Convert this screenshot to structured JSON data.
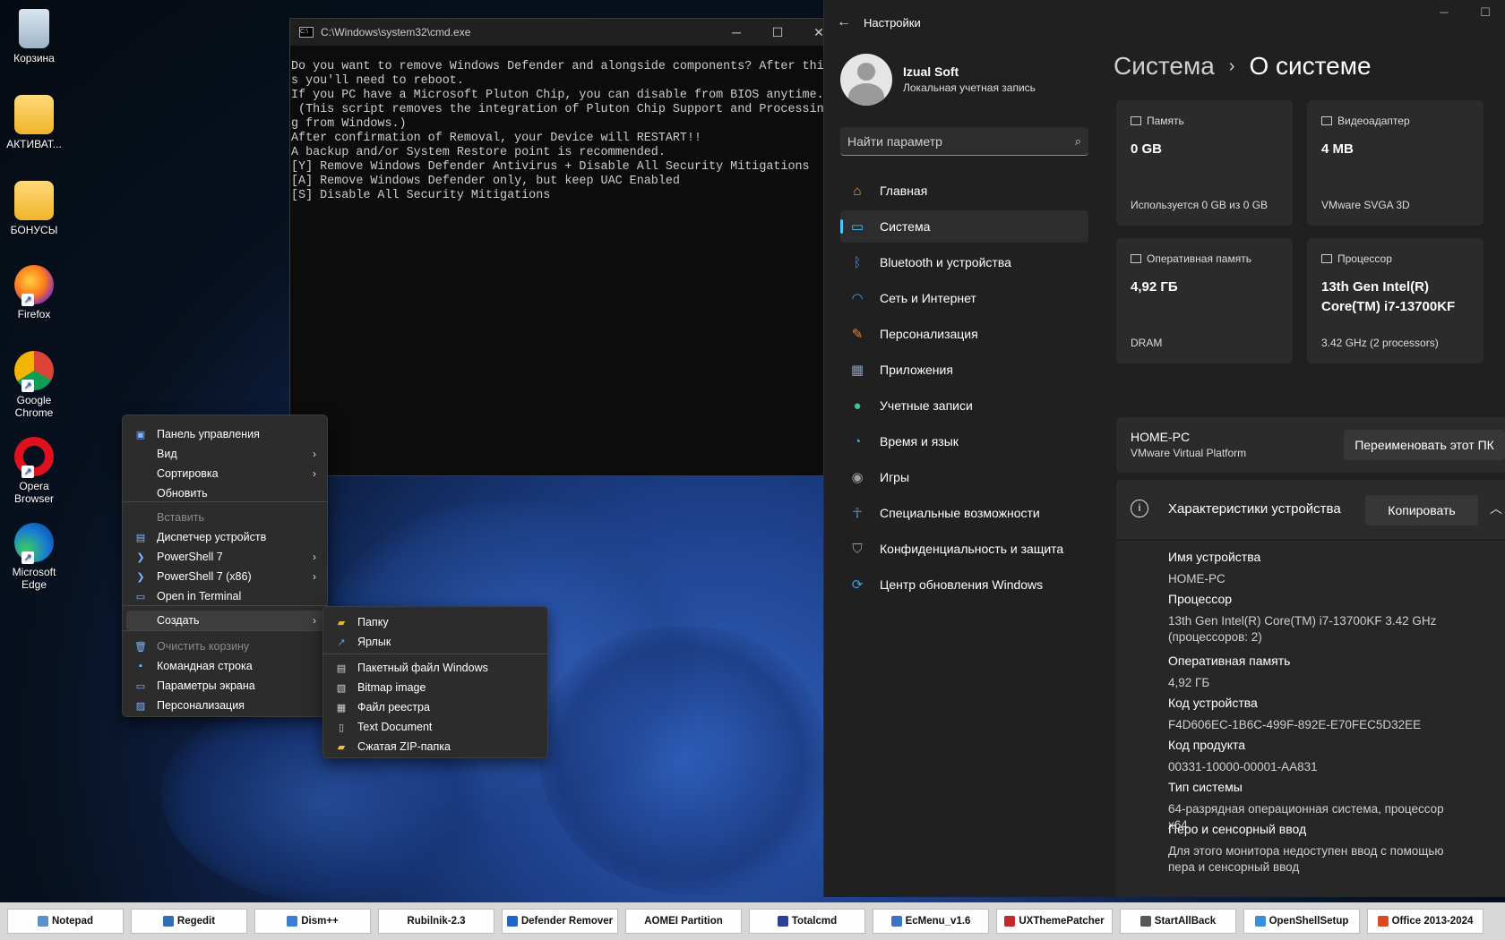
{
  "desktop": {
    "icons": [
      {
        "label": "Корзина",
        "icon": "recycle-bin-icon"
      },
      {
        "label": "АКТИВАТ...",
        "icon": "folder-icon"
      },
      {
        "label": "БОНУСЫ",
        "icon": "folder-icon"
      },
      {
        "label": "Firefox",
        "icon": "firefox-icon"
      },
      {
        "label": "Google Chrome",
        "icon": "chrome-icon"
      },
      {
        "label": "Opera Browser",
        "icon": "opera-icon"
      },
      {
        "label": "Microsoft Edge",
        "icon": "edge-icon"
      }
    ]
  },
  "cmd": {
    "title": "C:\\Windows\\system32\\cmd.exe",
    "lines": [
      "Do you want to remove Windows Defender and alongside components? After thi",
      "s you'll need to reboot.",
      "If you PC have a Microsoft Pluton Chip, you can disable from BIOS anytime.",
      " (This script removes the integration of Pluton Chip Support and Processin",
      "g from Windows.)",
      "After confirmation of Removal, your Device will RESTART!!",
      "A backup and/or System Restore point is recommended.",
      "[Y] Remove Windows Defender Antivirus + Disable All Security Mitigations",
      "[A] Remove Windows Defender only, but keep UAC Enabled",
      "[S] Disable All Security Mitigations"
    ]
  },
  "settings": {
    "window_title": "Настройки",
    "user": {
      "name": "Izual Soft",
      "type": "Локальная учетная запись"
    },
    "search_placeholder": "Найти параметр",
    "nav": [
      {
        "label": "Главная",
        "icon": "home-icon",
        "color": "#e8a33b"
      },
      {
        "label": "Система",
        "icon": "system-icon",
        "color": "#4cc2ff",
        "active": true
      },
      {
        "label": "Bluetooth и устройства",
        "icon": "bluetooth-icon",
        "color": "#2f8ff0"
      },
      {
        "label": "Сеть и Интернет",
        "icon": "wifi-icon",
        "color": "#3aa0e8"
      },
      {
        "label": "Персонализация",
        "icon": "brush-icon",
        "color": "#e88b3a"
      },
      {
        "label": "Приложения",
        "icon": "apps-icon",
        "color": "#8a9bb8"
      },
      {
        "label": "Учетные записи",
        "icon": "accounts-icon",
        "color": "#3ac48a"
      },
      {
        "label": "Время и язык",
        "icon": "time-language-icon",
        "color": "#3aa0e8"
      },
      {
        "label": "Игры",
        "icon": "gamepad-icon",
        "color": "#9aa0a6"
      },
      {
        "label": "Специальные возможности",
        "icon": "accessibility-icon",
        "color": "#3aa0e8"
      },
      {
        "label": "Конфиденциальность и защита",
        "icon": "shield-icon",
        "color": "#9aa0a6"
      },
      {
        "label": "Центр обновления Windows",
        "icon": "update-icon",
        "color": "#3aa0e8"
      }
    ],
    "breadcrumb": {
      "parent": "Система",
      "separator": "›",
      "current": "О системе"
    },
    "cards": [
      {
        "label": "Память",
        "value": "0 GB",
        "sub": "Используется 0 GB из 0 GB"
      },
      {
        "label": "Видеоадаптер",
        "value": "4 MB",
        "sub": "VMware SVGA 3D"
      },
      {
        "label": "Оперативная память",
        "value": "4,92 ГБ",
        "sub": "DRAM"
      },
      {
        "label": "Процессор",
        "value": "13th Gen Intel(R) Core(TM) i7-13700KF",
        "sub": "3.42 GHz (2 processors)"
      }
    ],
    "pc": {
      "name": "HOME-PC",
      "platform": "VMware Virtual Platform",
      "rename_label": "Переименовать этот ПК"
    },
    "specs": {
      "title": "Характеристики устройства",
      "copy_label": "Копировать",
      "rows": [
        {
          "key": "Имя устройства",
          "value": "HOME-PC"
        },
        {
          "key": "Процессор",
          "value": "13th Gen Intel(R) Core(TM) i7-13700KF   3.42 GHz (процессоров: 2)"
        },
        {
          "key": "Оперативная память",
          "value": "4,92 ГБ"
        },
        {
          "key": "Код устройства",
          "value": "F4D606EC-1B6C-499F-892E-E70FEC5D32EE"
        },
        {
          "key": "Код продукта",
          "value": "00331-10000-00001-AA831"
        },
        {
          "key": "Тип системы",
          "value": "64-разрядная операционная система, процессор x64"
        },
        {
          "key": "Перо и сенсорный ввод",
          "value": "Для этого монитора недоступен ввод с помощью пера и сенсорный ввод"
        }
      ]
    }
  },
  "context_menu": {
    "items": [
      {
        "label": "Панель управления",
        "icon": "control-panel-icon"
      },
      {
        "label": "Вид",
        "submenu": true
      },
      {
        "label": "Сортировка",
        "submenu": true
      },
      {
        "label": "Обновить"
      },
      {
        "label": "Вставить",
        "disabled": true
      },
      {
        "label": "Диспетчер устройств",
        "icon": "device-manager-icon"
      },
      {
        "label": "PowerShell 7",
        "icon": "powershell-icon",
        "submenu": true
      },
      {
        "label": "PowerShell 7 (x86)",
        "icon": "powershell-icon",
        "submenu": true
      },
      {
        "label": "Open in Terminal",
        "icon": "terminal-icon"
      },
      {
        "label": "Создать",
        "submenu": true,
        "highlighted": true
      },
      {
        "label": "Очистить корзину",
        "icon": "recycle-bin-icon",
        "disabled": true
      },
      {
        "label": "Командная строка",
        "icon": "cmd-icon"
      },
      {
        "label": "Параметры экрана",
        "icon": "display-icon"
      },
      {
        "label": "Персонализация",
        "icon": "personalize-icon"
      }
    ],
    "create_submenu": [
      {
        "label": "Папку",
        "icon": "folder-icon"
      },
      {
        "label": "Ярлык",
        "icon": "shortcut-icon"
      },
      {
        "label": "Пакетный файл Windows",
        "icon": "batch-file-icon"
      },
      {
        "label": "Bitmap image",
        "icon": "bitmap-icon"
      },
      {
        "label": "Файл реестра",
        "icon": "registry-file-icon"
      },
      {
        "label": "Text Document",
        "icon": "text-document-icon"
      },
      {
        "label": "Сжатая ZIP-папка",
        "icon": "zip-folder-icon"
      }
    ]
  },
  "taskbar": {
    "items": [
      {
        "label": "Notepad",
        "icon": "notepad-icon",
        "color": "#5d8fc9"
      },
      {
        "label": "Regedit",
        "icon": "regedit-icon",
        "color": "#2f6fb8"
      },
      {
        "label": "Dism++",
        "icon": "gear-icon",
        "color": "#3a7fd1"
      },
      {
        "label": "Rubilnik-2.3",
        "icon": "",
        "color": ""
      },
      {
        "label": "Defender Remover",
        "icon": "shield-icon",
        "color": "#1f64c8"
      },
      {
        "label": "AOMEI Partition",
        "icon": "",
        "color": ""
      },
      {
        "label": "Totalcmd",
        "icon": "floppy-icon",
        "color": "#2a3f9a"
      },
      {
        "label": "EcMenu_v1.6",
        "icon": "menu-icon",
        "color": "#3b73c4"
      },
      {
        "label": "UXThemePatcher",
        "icon": "patch-icon",
        "color": "#c02a2a"
      },
      {
        "label": "StartAllBack",
        "icon": "window-icon",
        "color": "#555555"
      },
      {
        "label": "OpenShellSetup",
        "icon": "shell-icon",
        "color": "#3a8fd8"
      },
      {
        "label": "Office 2013-2024",
        "icon": "office-icon",
        "color": "#d9491f"
      }
    ]
  }
}
